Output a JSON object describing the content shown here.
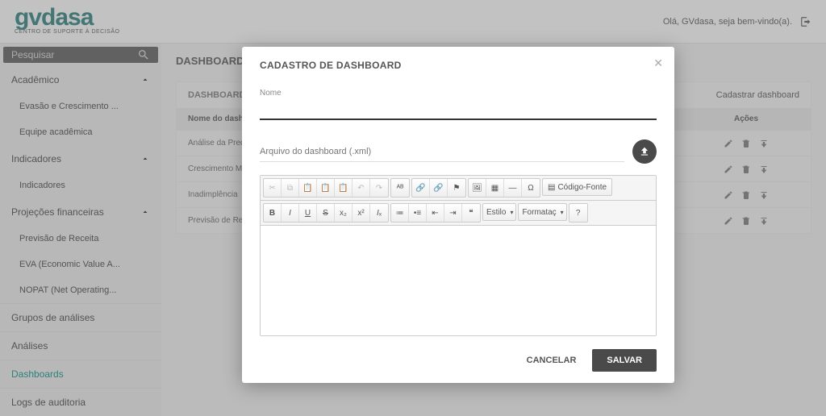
{
  "header": {
    "logo_main": "gvdasa",
    "logo_sub": "CENTRO DE SUPORTE À DECISÃO",
    "welcome": "Olá, GVdasa, seja bem-vindo(a)."
  },
  "sidebar": {
    "search_placeholder": "Pesquisar",
    "groups": [
      {
        "label": "Acadêmico",
        "items": [
          "Evasão e Crescimento ...",
          "Equipe acadêmica"
        ]
      },
      {
        "label": "Indicadores",
        "items": [
          "Indicadores"
        ]
      },
      {
        "label": "Projeções financeiras",
        "items": [
          "Previsão de Receita",
          "EVA (Economic Value A...",
          "NOPAT (Net Operating..."
        ]
      }
    ],
    "plain": [
      "Grupos de análises",
      "Análises",
      "Dashboards",
      "Logs de auditoria"
    ],
    "active_plain_index": 2
  },
  "content": {
    "title": "DASHBOARDS",
    "panel_title": "DASHBOARDS",
    "register_link": "Cadastrar dashboard",
    "col_name": "Nome do dashboard",
    "col_actions": "Ações",
    "rows": [
      "Análise da Predição de Evasão",
      "Crescimento Matricular",
      "Inadimplência",
      "Previsão de Receita"
    ]
  },
  "modal": {
    "title": "CADASTRO DE DASHBOARD",
    "name_label": "Nome",
    "file_placeholder": "Arquivo do dashboard (.xml)",
    "source_btn": "Código-Fonte",
    "style_select": "Estilo",
    "format_select": "Formataç",
    "cancel": "CANCELAR",
    "save": "SALVAR"
  }
}
